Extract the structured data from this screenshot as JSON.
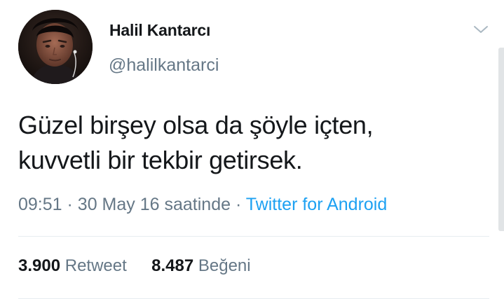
{
  "tweet": {
    "display_name": "Halil Kantarcı",
    "handle": "@halilkantarci",
    "text_lines": [
      "Güzel birşey olsa da şöyle içten,",
      "kuvvetli bir tekbir getirsek."
    ],
    "time": "09:51",
    "separator": "·",
    "date": "30 May 16 saatinde",
    "source": "Twitter for Android",
    "retweet_count": "3.900",
    "retweet_label": "Retweet",
    "like_count": "8.487",
    "like_label": "Beğeni"
  },
  "icons": {
    "caret": "chevron-down-icon",
    "avatar": "profile-photo"
  },
  "colors": {
    "text_primary": "#14171a",
    "text_secondary": "#657786",
    "link": "#1da1f2",
    "divider": "#e6ecf0"
  }
}
